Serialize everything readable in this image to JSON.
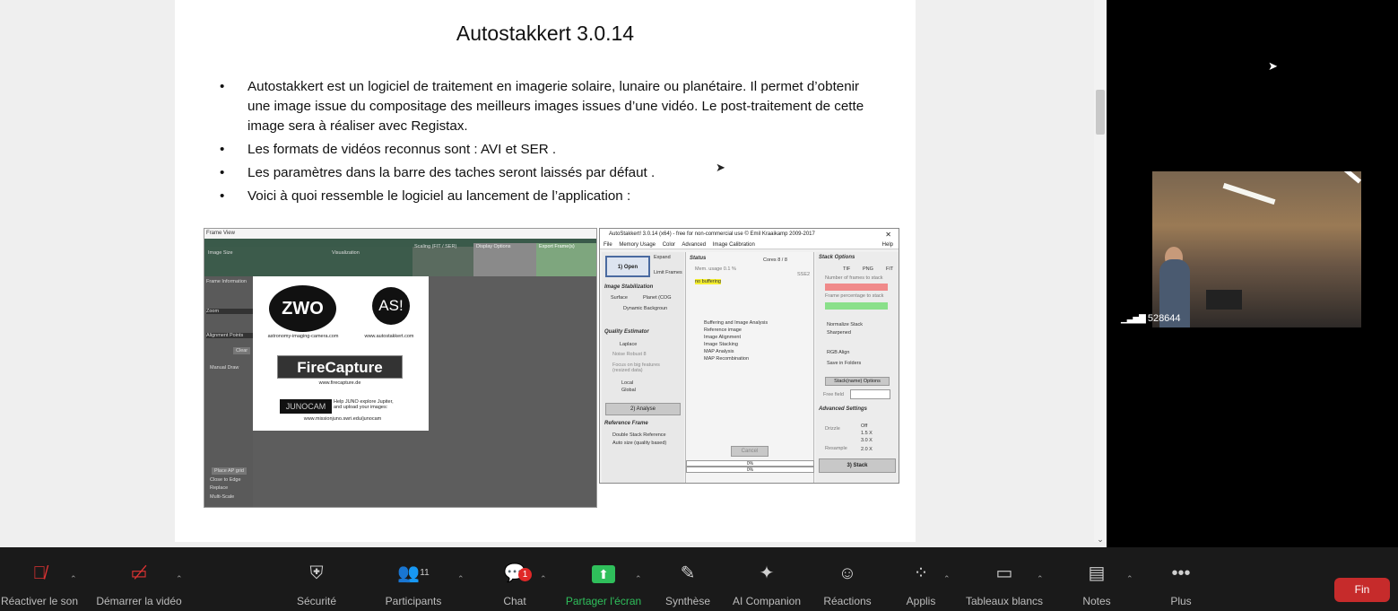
{
  "slide": {
    "title": "Autostakkert 3.0.14",
    "bullets": [
      "Autostakkert est un logiciel de traitement en imagerie solaire, lunaire ou planétaire. Il permet d’obtenir une image issue du compositage des meilleurs images issues d’une vidéo. Le post-traitement de cette image sera à réaliser avec Registax.",
      "Les formats de vidéos reconnus sont : AVI et SER .",
      "Les paramètres dans la barre des taches seront laissés par défaut .",
      "Voici à quoi ressemble le logiciel au lancement de l’application :"
    ]
  },
  "frame_view": {
    "title": "Frame View",
    "image_size": "Image Size",
    "visualization": "Visualization",
    "scaling": "Scaling (FIT / SER)",
    "display_options": "Display Options",
    "export_frames": "Export Frame(s)",
    "frame_information": "Frame Information",
    "zoom": "Zoom",
    "alignment_points": "Alignment Points",
    "clear": "Clear",
    "manual_draw": "Manual Draw",
    "place_ap_grid": "Place AP grid",
    "close_to_edge": "Close to Edge",
    "replace": "Replace",
    "multi_scale": "Multi-Scale",
    "logo_zwo": "ZWO",
    "logo_asi": "AS!",
    "logo_firecapture": "FireCapture",
    "logo_junocam": "JUNOCAM",
    "url_zwo": "astronomy-imaging-camera.com",
    "url_as": "www.autostakkert.com",
    "url_fc": "www.firecapture.de",
    "juno_text": "Help JUNO explore Jupiter, and upload your images:",
    "url_juno": "www.missionjuno.swri.edu/junocam"
  },
  "autostakkert": {
    "title": "AutoStakkert! 3.0.14 (x64) - free for non-commercial use © Emil Kraaikamp 2009-2017",
    "menu": [
      "File",
      "Memory Usage",
      "Color",
      "Advanced",
      "Image Calibration",
      "Help"
    ],
    "open_button": "1) Open",
    "expand": "Expand",
    "limit_frames": "Limit Frames",
    "status_label": "Status",
    "cores": "Cores 8 / 8",
    "mem_usage": "Mem. usage 0.1 %",
    "no_buffering": "no buffering",
    "sse": "SSE2",
    "image_stabilization": "Image Stabilization",
    "surface": "Surface",
    "planet": "Planet (COG",
    "dynamic_background": "Dynamic Backgroun",
    "quality_estimator": "Quality Estimator",
    "laplace": "Laplace",
    "noise_robust": "Noise Robust 8",
    "focus_on_big": "Focus on big features (resized data)",
    "local": "Local",
    "global": "Global",
    "analyse_button": "2) Analyse",
    "reference_frame": "Reference Frame",
    "double_stack": "Double Stack Reference",
    "auto_size": "Auto size (quality based)",
    "steps": [
      "Buffering and Image Analysis",
      "Reference image",
      "Image Alignment",
      "Image Stacking",
      "MAP Analysis",
      "MAP Recombination"
    ],
    "cancel": "Cancel",
    "progress1": "0%",
    "progress2": "0%",
    "stack_options": "Stack Options",
    "formats": [
      "TIF",
      "PNG",
      "FIT"
    ],
    "num_frames": "Number of frames to stack",
    "frame_percent": "Frame percentage to stack",
    "normalize_stack": "Normalize Stack",
    "sharpened": "Sharpened",
    "rgb_align": "RGB Align",
    "save_in_folders": "Save in Folders",
    "stack_options_btn": "Stack(name) Options",
    "free_field": "Free field",
    "advanced_settings": "Advanced Settings",
    "drizzle": "Drizzle",
    "drizzle_opts": [
      "Off",
      "1.5 X",
      "3.0 X"
    ],
    "resample": "Resample",
    "resample_opt": "2.0 X",
    "stack_button": "3) Stack"
  },
  "webcam": {
    "participant_id": "528644"
  },
  "toolbar": {
    "items": [
      {
        "label": "Réactiver le son",
        "icon": "mic-muted-icon"
      },
      {
        "label": "Démarrer la vidéo",
        "icon": "video-off-icon"
      },
      {
        "label": "Sécurité",
        "icon": "shield-icon"
      },
      {
        "label": "Participants",
        "icon": "participants-icon",
        "count": "11"
      },
      {
        "label": "Chat",
        "icon": "chat-icon",
        "badge": "1"
      },
      {
        "label": "Partager l'écran",
        "icon": "share-screen-icon"
      },
      {
        "label": "Synthèse",
        "icon": "summary-icon"
      },
      {
        "label": "AI Companion",
        "icon": "sparkle-icon"
      },
      {
        "label": "Réactions",
        "icon": "emoji-icon"
      },
      {
        "label": "Applis",
        "icon": "apps-icon"
      },
      {
        "label": "Tableaux blancs",
        "icon": "whiteboard-icon"
      },
      {
        "label": "Notes",
        "icon": "notes-icon"
      },
      {
        "label": "Plus",
        "icon": "more-icon"
      }
    ],
    "end_label": "Fin",
    "share_color": "#2fbf5b",
    "end_color": "#c62b2b"
  }
}
